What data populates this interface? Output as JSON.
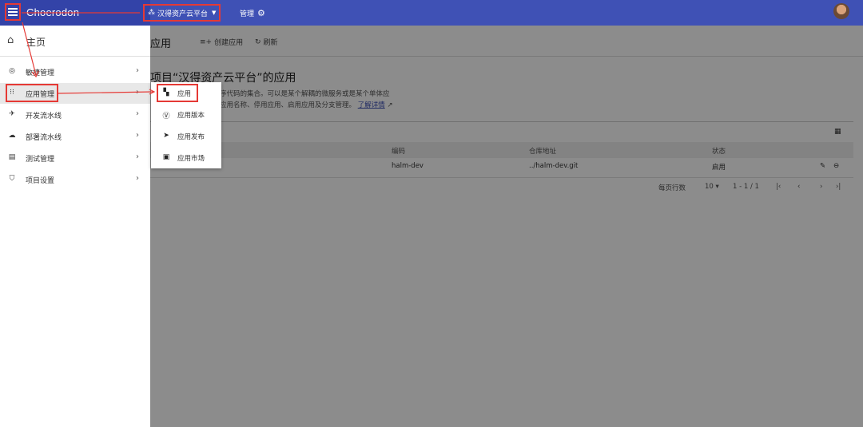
{
  "header": {
    "brand": "Choerodon",
    "project_name": "汉得资产云平台",
    "manage_label": "管理"
  },
  "page": {
    "title": "应用",
    "create_label": "创建应用",
    "refresh_label": "刷新",
    "heading": "项目“汉得资产云平台”的应用",
    "desc_line1": "的程序代码的集合。可以是某个解耦的微服务或是某个单体应",
    "desc_line2": "修改应用名称、停用应用、启用应用及分支管理。",
    "learn_more": "了解详情"
  },
  "table": {
    "headers": {
      "code": "编码",
      "repo": "仓库地址",
      "status": "状态"
    },
    "rows": [
      {
        "code": "halm-dev",
        "repo": "../halm-dev.git",
        "status": "启用"
      }
    ],
    "pager": {
      "rows_per_page_label": "每页行数",
      "page_size": "10",
      "range": "1 - 1 / 1"
    }
  },
  "sidebar": {
    "home_label": "主页",
    "items": [
      {
        "label": "敏捷管理"
      },
      {
        "label": "应用管理"
      },
      {
        "label": "开发流水线"
      },
      {
        "label": "部署流水线"
      },
      {
        "label": "测试管理"
      },
      {
        "label": "项目设置"
      }
    ]
  },
  "submenu": {
    "items": [
      {
        "label": "应用"
      },
      {
        "label": "应用版本"
      },
      {
        "label": "应用发布"
      },
      {
        "label": "应用市场"
      }
    ]
  },
  "colors": {
    "header": "#3f51b5",
    "annotation": "#e53935"
  }
}
